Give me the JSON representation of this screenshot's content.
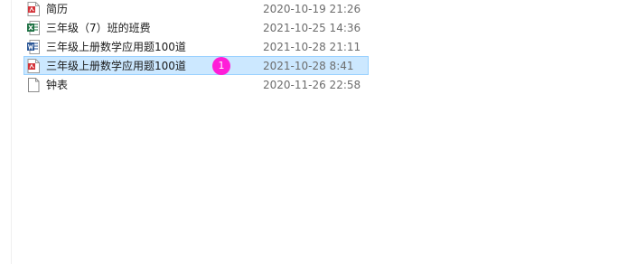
{
  "files": [
    {
      "name": "简历",
      "modified": "2020-10-19 21:26",
      "icon": "pdf-file-icon",
      "selected": false
    },
    {
      "name": "三年级（7）班的班费",
      "modified": "2021-10-25 14:36",
      "icon": "excel-file-icon",
      "selected": false
    },
    {
      "name": "三年级上册数学应用题100道",
      "modified": "2021-10-28 21:11",
      "icon": "word-file-icon",
      "selected": false
    },
    {
      "name": "三年级上册数学应用题100道",
      "modified": "2021-10-28 8:41",
      "icon": "pdf-file-icon",
      "selected": true,
      "badge": "1"
    },
    {
      "name": "钟表",
      "modified": "2020-11-26 22:58",
      "icon": "blank-file-icon",
      "selected": false
    }
  ],
  "colors": {
    "selection_bg": "#cce8ff",
    "selection_border": "#99d1ff",
    "badge": "#ff1dd8",
    "pdf": "#d4343a",
    "excel": "#1f7244",
    "word": "#2b5797"
  }
}
